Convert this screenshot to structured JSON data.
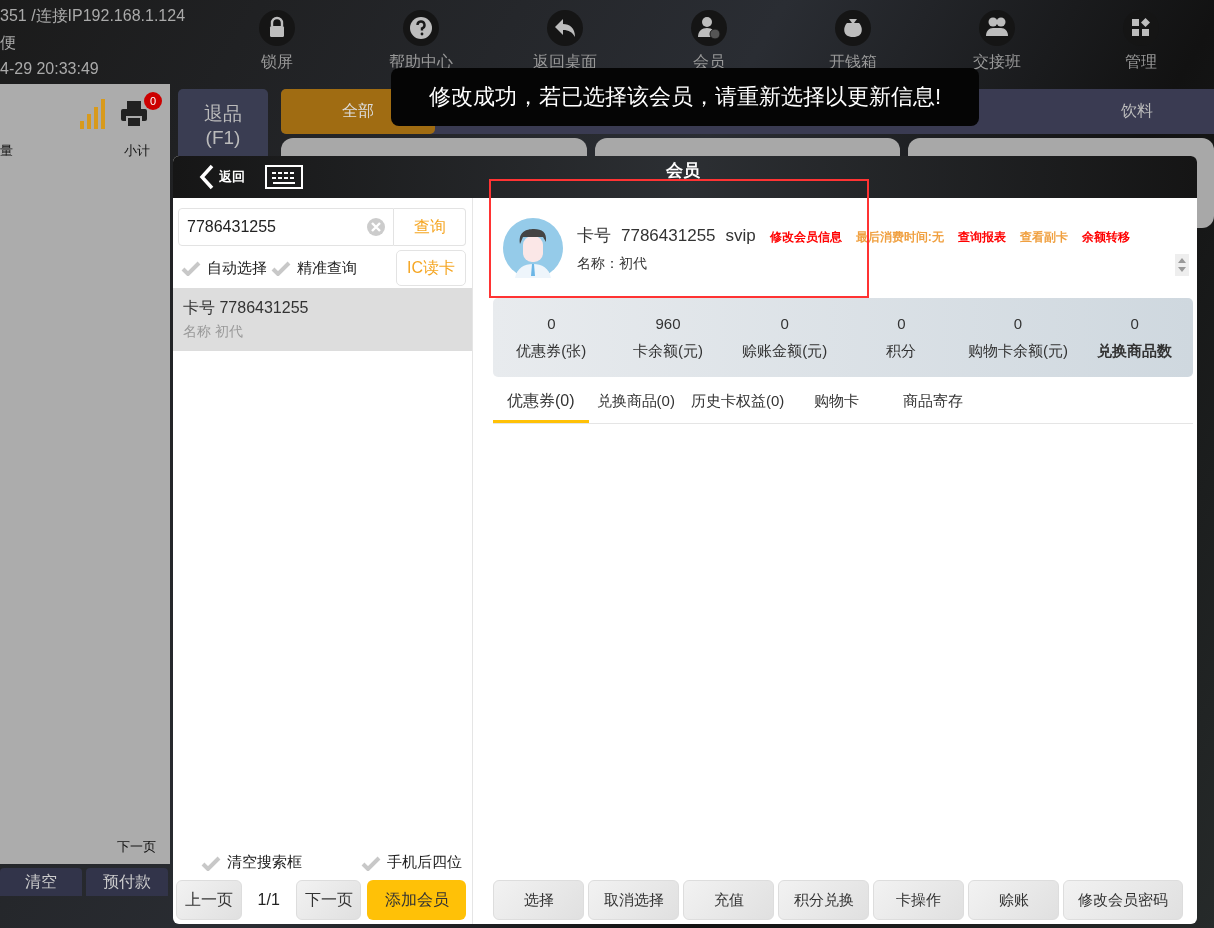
{
  "status": {
    "connection": "351 /连接IP192.168.1.124",
    "store": "便",
    "time": "4-29 20:33:49"
  },
  "nav": [
    {
      "label": "锁屏",
      "kind": "lock"
    },
    {
      "label": "帮助中心",
      "kind": "help"
    },
    {
      "label": "返回桌面",
      "kind": "back"
    },
    {
      "label": "会员",
      "kind": "member"
    },
    {
      "label": "开钱箱",
      "kind": "cash"
    },
    {
      "label": "交接班",
      "kind": "shift"
    },
    {
      "label": "管理",
      "kind": "manage"
    }
  ],
  "cart": {
    "columns": [
      "量",
      "小计"
    ],
    "printer_badge": "0",
    "next_page": "下一页"
  },
  "bottom_buttons": [
    "清空",
    "预付款"
  ],
  "return_button": {
    "label": "退品",
    "shortcut": "(F1)"
  },
  "categories": [
    {
      "label": "全部",
      "selected": true
    },
    {
      "label": "饮料",
      "selected": false
    }
  ],
  "toast": "修改成功，若已选择该会员，请重新选择以更新信息!",
  "member_dialog": {
    "back": "返回",
    "title": "会员",
    "search": {
      "value": "7786431255",
      "button": "查询"
    },
    "options": [
      {
        "label": "自动选择",
        "checked": false
      },
      {
        "label": "精准查询",
        "checked": false
      }
    ],
    "ic_button": "IC读卡",
    "results": [
      {
        "card": "卡号 7786431255",
        "name": "名称 初代",
        "selected": true
      }
    ],
    "bottom_options": [
      {
        "label": "清空搜索框",
        "checked": false
      },
      {
        "label": "手机后四位",
        "checked": false
      }
    ],
    "pager": {
      "prev": "上一页",
      "page": "1/1",
      "next": "下一页",
      "add": "添加会员"
    },
    "member": {
      "card_label": "卡号",
      "card_no": "7786431255",
      "level": "svip",
      "name": "名称：初代",
      "links": [
        {
          "label": "修改会员信息",
          "color": "#ff0000"
        },
        {
          "label": "最后消费时间:无",
          "color": "#f0a040"
        },
        {
          "label": "查询报表",
          "color": "#ff0000"
        },
        {
          "label": "查看副卡",
          "color": "#f0a040"
        },
        {
          "label": "余额转移",
          "color": "#ff0000"
        }
      ]
    },
    "stats": [
      {
        "value": "0",
        "label": "优惠券(张)",
        "emphasis": false
      },
      {
        "value": "960",
        "label": "卡余额(元)",
        "emphasis": false
      },
      {
        "value": "0",
        "label": "赊账金额(元)",
        "emphasis": false
      },
      {
        "value": "0",
        "label": "积分",
        "emphasis": false
      },
      {
        "value": "0",
        "label": "购物卡余额(元)",
        "emphasis": false
      },
      {
        "value": "0",
        "label": "兑换商品数",
        "emphasis": true
      }
    ],
    "tabs": [
      {
        "label": "优惠券(0)",
        "selected": true
      },
      {
        "label": "兑换商品(0)",
        "selected": false
      },
      {
        "label": "历史卡权益(0)",
        "selected": false
      },
      {
        "label": "购物卡",
        "selected": false
      },
      {
        "label": "商品寄存",
        "selected": false
      }
    ],
    "actions": [
      "选择",
      "取消选择",
      "充值",
      "积分兑换",
      "卡操作",
      "赊账",
      "修改会员密码"
    ]
  }
}
